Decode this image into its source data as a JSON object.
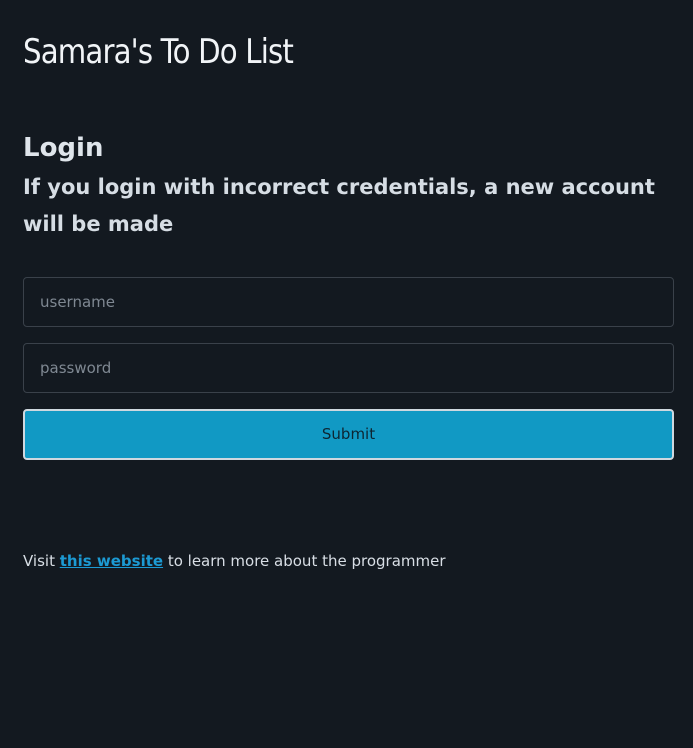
{
  "app": {
    "title": "Samara's To Do List"
  },
  "login": {
    "heading": "Login",
    "subtitle": "If you login with incorrect credentials, a new account will be made",
    "username_placeholder": "username",
    "password_placeholder": "password",
    "submit_label": "Submit"
  },
  "footer": {
    "prefix": "Visit ",
    "link_text": "this website",
    "suffix": " to learn more about the programmer"
  },
  "colors": {
    "background": "#131920",
    "accent": "#1199c4",
    "link": "#1c9ad3"
  }
}
